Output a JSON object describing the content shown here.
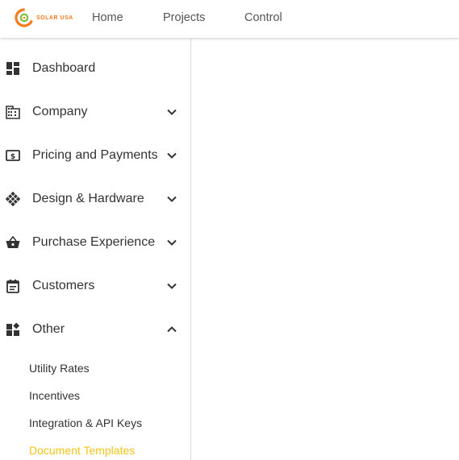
{
  "brand": {
    "logo_text": "SOLAR USA",
    "accent_orange": "#f47b20",
    "accent_green": "#7cbf3a",
    "active_yellow": "#f5c518"
  },
  "topnav": {
    "home": "Home",
    "projects": "Projects",
    "control": "Control"
  },
  "sidebar": {
    "items": [
      {
        "label": "Dashboard",
        "icon": "dashboard-icon",
        "expandable": false
      },
      {
        "label": "Company",
        "icon": "company-icon",
        "expandable": true,
        "expanded": false
      },
      {
        "label": "Pricing and Payments",
        "icon": "money-icon",
        "expandable": true,
        "expanded": false
      },
      {
        "label": "Design & Hardware",
        "icon": "solar-panel-icon",
        "expandable": true,
        "expanded": false
      },
      {
        "label": "Purchase Experience",
        "icon": "basket-icon",
        "expandable": true,
        "expanded": false
      },
      {
        "label": "Customers",
        "icon": "calendar-list-icon",
        "expandable": true,
        "expanded": false
      },
      {
        "label": "Other",
        "icon": "widgets-icon",
        "expandable": true,
        "expanded": true
      }
    ],
    "other_subitems": [
      {
        "label": "Utility Rates",
        "active": false
      },
      {
        "label": "Incentives",
        "active": false
      },
      {
        "label": "Integration & API Keys",
        "active": false
      },
      {
        "label": "Document Templates",
        "active": true
      }
    ]
  }
}
